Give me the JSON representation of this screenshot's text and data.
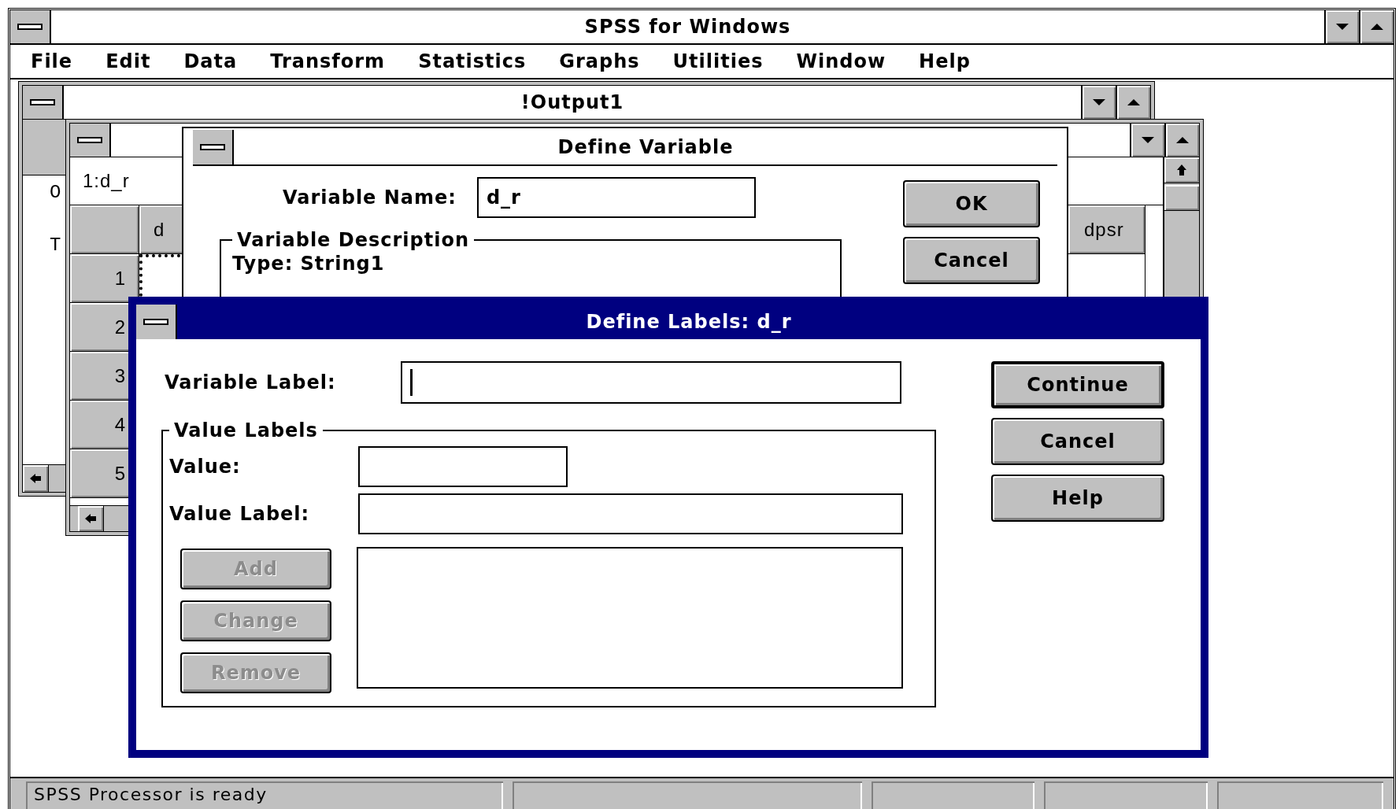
{
  "main_window": {
    "title": "SPSS for Windows",
    "active": false,
    "menu": [
      {
        "label": "File"
      },
      {
        "label": "Edit"
      },
      {
        "label": "Data"
      },
      {
        "label": "Transform"
      },
      {
        "label": "Statistics"
      },
      {
        "label": "Graphs"
      },
      {
        "label": "Utilities"
      },
      {
        "label": "Window"
      },
      {
        "label": "Help"
      }
    ]
  },
  "output_window": {
    "title": "!Output1",
    "active": false,
    "lines": [
      "O",
      "T"
    ]
  },
  "data_editor": {
    "active": false,
    "cell_reference": "1:d_r",
    "columns": [
      "d",
      "dpsr"
    ],
    "rows": [
      "1",
      "2",
      "3",
      "4",
      "5"
    ]
  },
  "define_variable": {
    "title": "Define Variable",
    "active": false,
    "name_label": "Variable Name:",
    "name_value": "d_r",
    "group_title": "Variable Description",
    "type_line": "Type: String1",
    "buttons": [
      {
        "label": "OK",
        "default": false
      },
      {
        "label": "Cancel",
        "default": false
      }
    ]
  },
  "define_labels": {
    "title": "Define Labels: d_r",
    "active": true,
    "variable_label": {
      "label": "Variable Label:",
      "focused": true
    },
    "group_title": "Value Labels",
    "fields": [
      {
        "label": "Value:",
        "kind": "short"
      },
      {
        "label": "Value Label:",
        "kind": "long"
      }
    ],
    "list_buttons": [
      {
        "label": "Add",
        "disabled": true
      },
      {
        "label": "Change",
        "disabled": true
      },
      {
        "label": "Remove",
        "disabled": true
      }
    ],
    "buttons": [
      {
        "label": "Continue",
        "default": true
      },
      {
        "label": "Cancel",
        "default": false
      },
      {
        "label": "Help",
        "default": false
      }
    ]
  },
  "status_bar": {
    "message": "SPSS Processor is ready"
  }
}
